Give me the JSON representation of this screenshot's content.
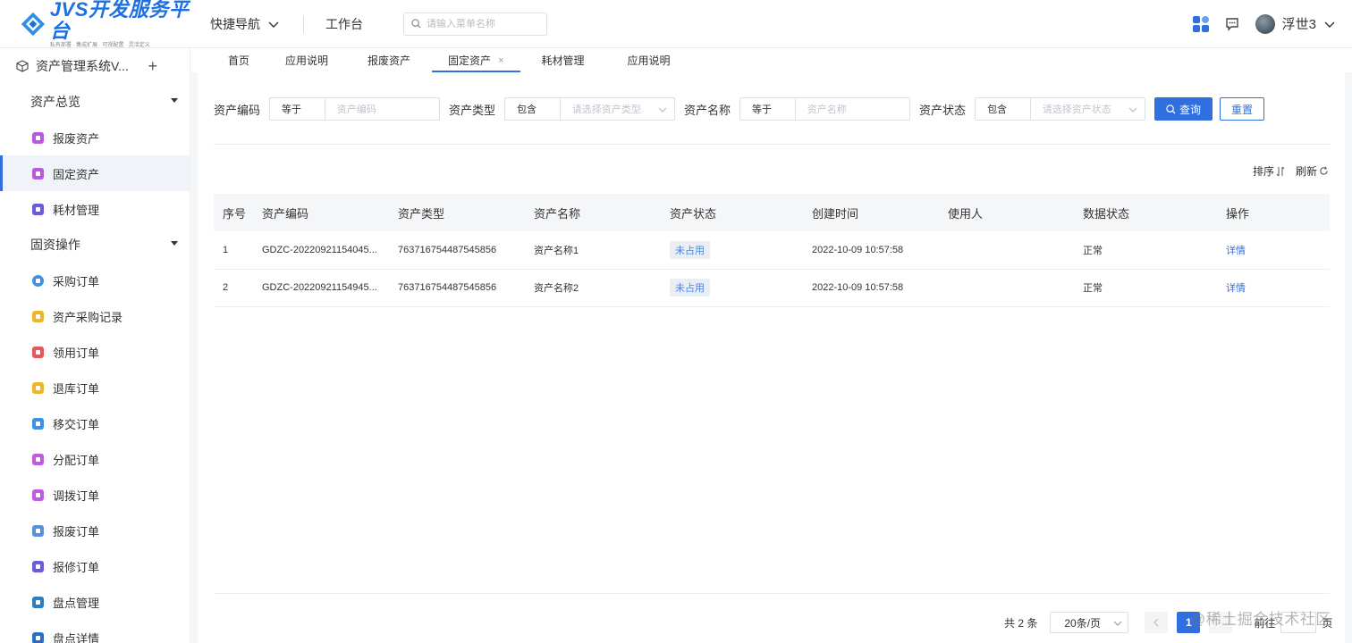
{
  "header": {
    "logo_title": "JVS开发服务平台",
    "logo_subtitle": "私有部署 · 集成扩展 · 可视配置 · 灵活定义",
    "quick_nav": "快捷导航",
    "workbench": "工作台",
    "search_placeholder": "请输入菜单名称",
    "user_name": "浮世3"
  },
  "sidebar": {
    "system_name": "资产管理系统V...",
    "groups": [
      {
        "label": "资产总览"
      },
      {
        "label": "固资操作"
      }
    ],
    "items": [
      {
        "label": "报废资产",
        "color": "#b85ae0"
      },
      {
        "label": "固定资产",
        "color": "#b85ae0"
      },
      {
        "label": "耗材管理",
        "color": "#6a5ae0"
      },
      {
        "label": "采购订单",
        "color": "#3d8fe8"
      },
      {
        "label": "资产采购记录",
        "color": "#f0b429"
      },
      {
        "label": "领用订单",
        "color": "#e8555a"
      },
      {
        "label": "退库订单",
        "color": "#f0b429"
      },
      {
        "label": "移交订单",
        "color": "#3d8fe8"
      },
      {
        "label": "分配订单",
        "color": "#c05ae0"
      },
      {
        "label": "调拨订单",
        "color": "#c05ae0"
      },
      {
        "label": "报废订单",
        "color": "#5a8fe0"
      },
      {
        "label": "报修订单",
        "color": "#6a5ae0"
      },
      {
        "label": "盘点管理",
        "color": "#2a7fc0"
      },
      {
        "label": "盘点详情",
        "color": "#2a6fc0"
      }
    ]
  },
  "tabs": [
    {
      "label": "首页"
    },
    {
      "label": "应用说明"
    },
    {
      "label": "报废资产"
    },
    {
      "label": "固定资产",
      "close": "×"
    },
    {
      "label": "耗材管理"
    },
    {
      "label": "应用说明"
    }
  ],
  "filters": [
    {
      "label": "资产编码",
      "op": "等于",
      "placeholder": "资产编码"
    },
    {
      "label": "资产类型",
      "op": "包含",
      "placeholder": "请选择资产类型"
    },
    {
      "label": "资产名称",
      "op": "等于",
      "placeholder": "资产名称"
    },
    {
      "label": "资产状态",
      "op": "包含",
      "placeholder": "请选择资产状态"
    }
  ],
  "buttons": {
    "query": "查询",
    "reset": "重置",
    "sort": "排序",
    "refresh": "刷新"
  },
  "table": {
    "columns": [
      "序号",
      "资产编码",
      "资产类型",
      "资产名称",
      "资产状态",
      "创建时间",
      "使用人",
      "数据状态",
      "操作"
    ],
    "rows": [
      {
        "no": "1",
        "code": "GDZC-20220921154045...",
        "type": "763716754487545856",
        "name": "资产名称1",
        "status": "未占用",
        "created": "2022-10-09 10:57:58",
        "user": "",
        "data_status": "正常",
        "action": "详情"
      },
      {
        "no": "2",
        "code": "GDZC-20220921154945...",
        "type": "763716754487545856",
        "name": "资产名称2",
        "status": "未占用",
        "created": "2022-10-09 10:57:58",
        "user": "",
        "data_status": "正常",
        "action": "详情"
      }
    ]
  },
  "pagination": {
    "total": "共 2 条",
    "page_size": "20条/页",
    "current": "1",
    "goto_prefix": "前往",
    "goto_suffix": "页"
  },
  "watermark": "@稀土掘金技术社区"
}
